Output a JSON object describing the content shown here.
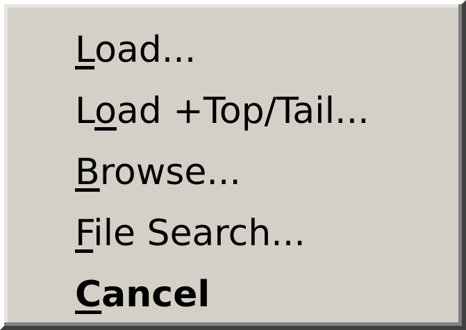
{
  "menu": {
    "items": [
      {
        "label": "Load...",
        "mnemonic_index": 0
      },
      {
        "label": "Load +Top/Tail...",
        "mnemonic_index": 1
      },
      {
        "label": "Browse...",
        "mnemonic_index": 0
      },
      {
        "label": "File Search...",
        "mnemonic_index": 0
      },
      {
        "label": "Cancel",
        "mnemonic_index": 0,
        "default": true
      }
    ]
  },
  "colors": {
    "menu_background": "#d4d0c8",
    "text": "#000000",
    "highlight_border": "#ffffff",
    "shadow_border": "#404040"
  }
}
